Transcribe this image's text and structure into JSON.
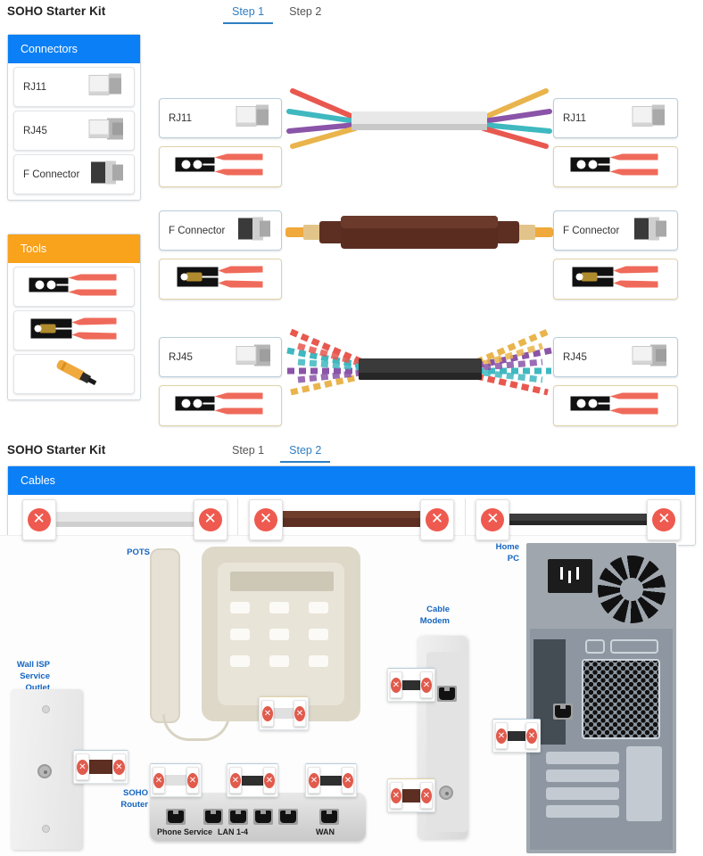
{
  "section1": {
    "title": "SOHO Starter Kit",
    "tabs": [
      {
        "label": "Step 1",
        "active": true
      },
      {
        "label": "Step 2",
        "active": false
      }
    ],
    "connectors_panel": {
      "header": "Connectors",
      "items": [
        {
          "label": "RJ11",
          "icon": "rj11-connector-icon"
        },
        {
          "label": "RJ45",
          "icon": "rj45-connector-icon"
        },
        {
          "label": "F Connector",
          "icon": "f-connector-icon"
        }
      ]
    },
    "tools_panel": {
      "header": "Tools",
      "items": [
        {
          "label": "",
          "icon": "rj-crimper-tool-icon"
        },
        {
          "label": "",
          "icon": "coax-crimper-tool-icon"
        },
        {
          "label": "",
          "icon": "punch-down-tool-icon"
        }
      ]
    },
    "assemblies": [
      {
        "name": "phone-cable-assembly",
        "left_connector": "RJ11",
        "left_tool": "rj-crimper-tool-icon",
        "right_connector": "RJ11",
        "right_tool": "rj-crimper-tool-icon",
        "cable": "flat-grey-phone-cable",
        "cable_color": "#dcdcdc",
        "wire_colors": [
          "#e8584f",
          "#3fb8c0",
          "#8a54a8",
          "#e9b44c"
        ]
      },
      {
        "name": "coax-cable-assembly",
        "left_connector": "F Connector",
        "left_tool": "coax-crimper-tool-icon",
        "right_connector": "F Connector",
        "right_tool": "coax-crimper-tool-icon",
        "cable": "coaxial-cable",
        "cable_color": "#5d2f22",
        "wire_colors": [
          "#e2c48a",
          "#f0a93c"
        ]
      },
      {
        "name": "ethernet-cable-assembly",
        "left_connector": "RJ45",
        "left_tool": "rj-crimper-tool-icon",
        "right_connector": "RJ45",
        "right_tool": "rj-crimper-tool-icon",
        "cable": "ethernet-twisted-pair-cable",
        "cable_color": "#343434",
        "wire_colors": [
          "#e8584f",
          "#3fb8c0",
          "#8a54a8",
          "#e9b44c"
        ]
      }
    ]
  },
  "section2": {
    "title": "SOHO Starter Kit",
    "tabs": [
      {
        "label": "Step 1",
        "active": false
      },
      {
        "label": "Step 2",
        "active": true
      }
    ],
    "cables_panel": {
      "header": "Cables",
      "items": [
        {
          "name": "phone-cable",
          "color": "#e2e2e2",
          "left_state": "x",
          "right_state": "x"
        },
        {
          "name": "coax-cable",
          "color": "#6b3a2a",
          "left_state": "x",
          "right_state": "x"
        },
        {
          "name": "ethernet-cable",
          "color": "#3a3a3a",
          "left_state": "x",
          "right_state": "x"
        }
      ]
    },
    "diagram": {
      "labels": [
        {
          "id": "pots",
          "text": "POTS"
        },
        {
          "id": "wall-isp",
          "text": "Wall ISP\nService\nOutlet"
        },
        {
          "id": "soho-router",
          "text": "SOHO\nRouter"
        },
        {
          "id": "cable-modem",
          "text": "Cable\nModem"
        },
        {
          "id": "home-pc",
          "text": "Home\nPC"
        }
      ],
      "wall_outlet_label": "Wall ISP Service Outlet",
      "pots_label": "POTS",
      "router_label": "SOHO Router",
      "modem_label": "Cable Modem",
      "pc_label": "Home PC",
      "router_ports": [
        {
          "label": "Phone Service"
        },
        {
          "label": "LAN 1-4"
        },
        {
          "label": "WAN"
        }
      ],
      "drop_targets": [
        {
          "id": "wall-outlet-coax-drop",
          "cable": "coax-cable",
          "color": "#6b3a2a"
        },
        {
          "id": "phone-handset-drop",
          "cable": "phone-cable",
          "color": "#e2e2e2"
        },
        {
          "id": "router-phone-service-drop",
          "cable": "phone-cable",
          "color": "#e2e2e2"
        },
        {
          "id": "router-lan-drop",
          "cable": "ethernet-cable",
          "color": "#3a3a3a"
        },
        {
          "id": "router-wan-drop",
          "cable": "ethernet-cable",
          "color": "#3a3a3a"
        },
        {
          "id": "modem-ethernet-drop",
          "cable": "ethernet-cable",
          "color": "#3a3a3a"
        },
        {
          "id": "modem-coax-drop",
          "cable": "coax-cable",
          "color": "#6b3a2a"
        },
        {
          "id": "pc-ethernet-drop",
          "cable": "ethernet-cable",
          "color": "#3a3a3a"
        }
      ]
    }
  },
  "colors": {
    "accent_blue": "#0b7ff5",
    "tab_blue": "#2f7fc1",
    "tools_orange": "#f9a21b",
    "error_red": "#ee5a4f",
    "label_blue": "#1565c0"
  }
}
